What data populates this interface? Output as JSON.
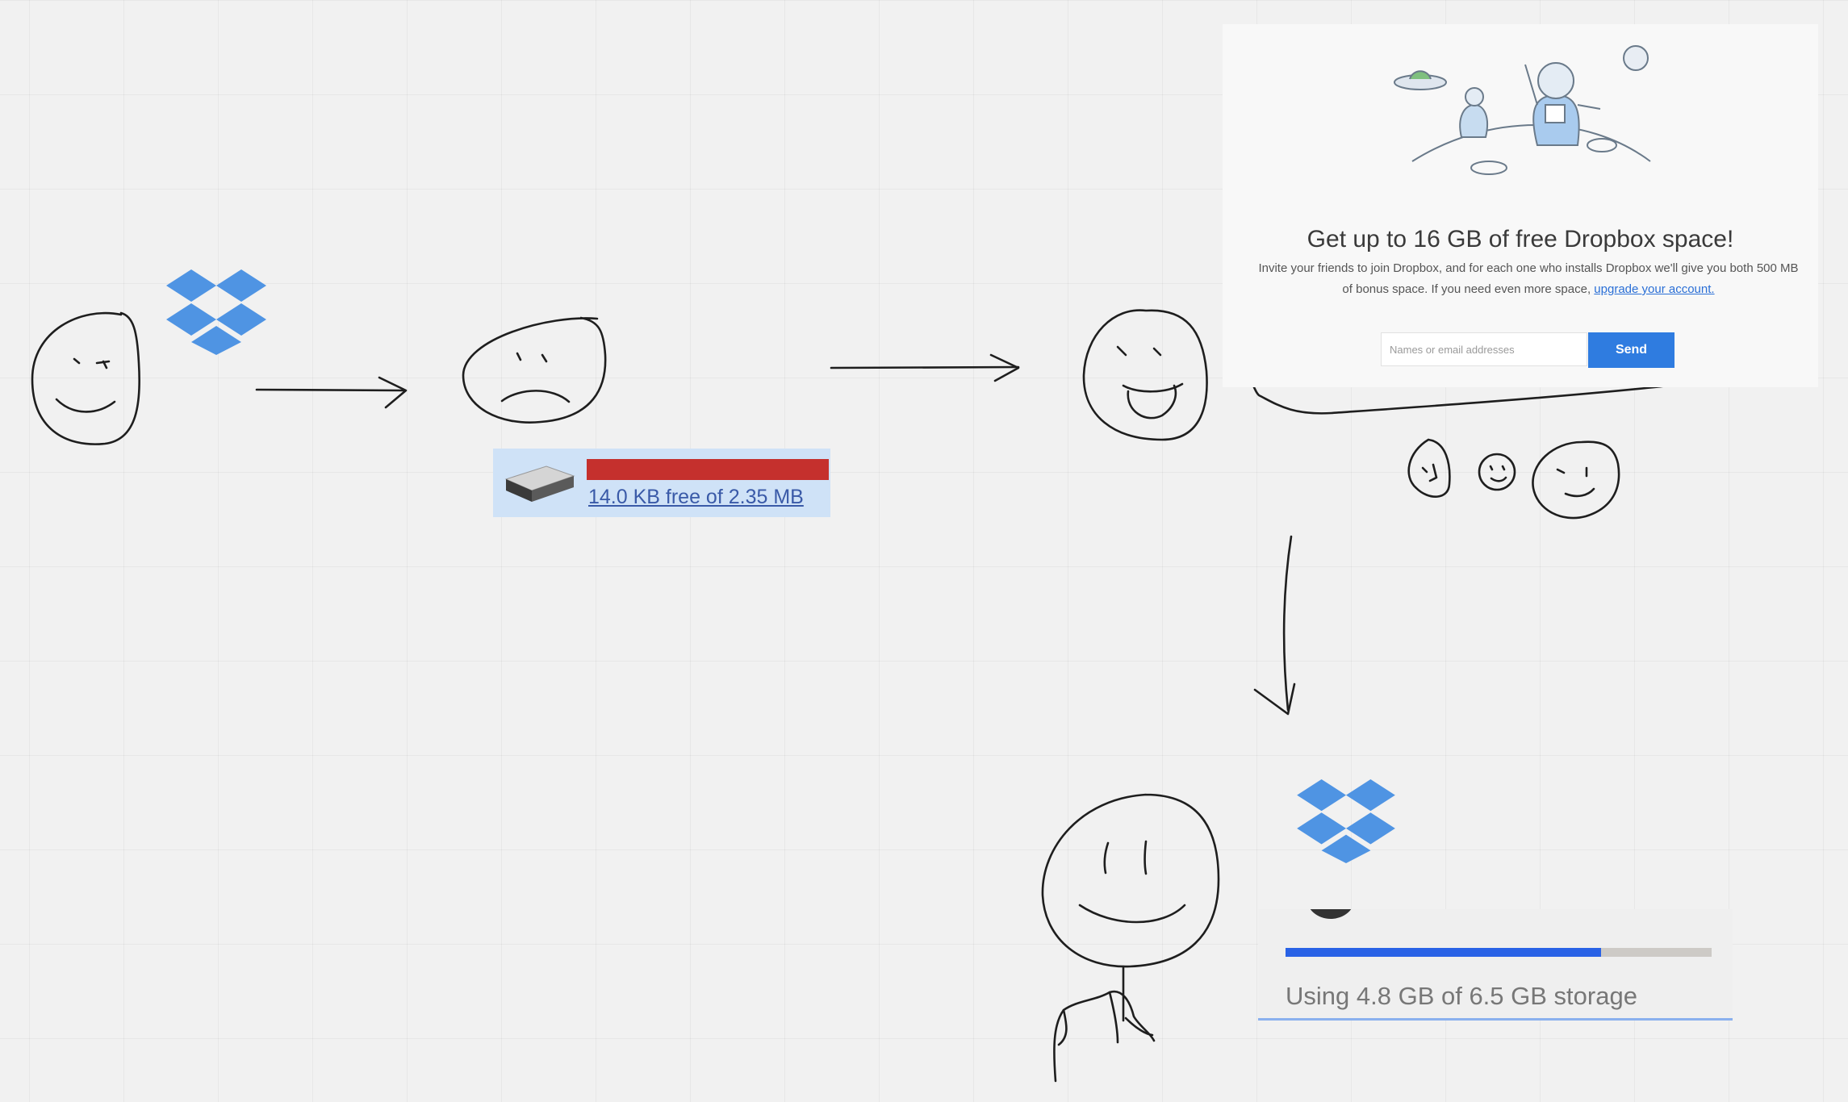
{
  "referral": {
    "title": "Get up to 16 GB of free Dropbox space!",
    "description": "Invite your friends to join Dropbox, and for each one who installs Dropbox we'll give you both 500 MB of bonus space. If you need even more space,",
    "link": "upgrade your account.",
    "input_placeholder": "Names or email addresses",
    "send_label": "Send"
  },
  "disk": {
    "free_text": "14.0 KB free of 2.35 MB",
    "used_fraction": 0.994,
    "bar_color": "#c5302d"
  },
  "storage": {
    "usage_text": "Using 4.8 GB of 6.5 GB storage",
    "used_fraction": 0.74,
    "bar_color": "#2962e6"
  },
  "colors": {
    "dropbox_blue": "#4f94e3",
    "ink": "#1e1e1e"
  }
}
